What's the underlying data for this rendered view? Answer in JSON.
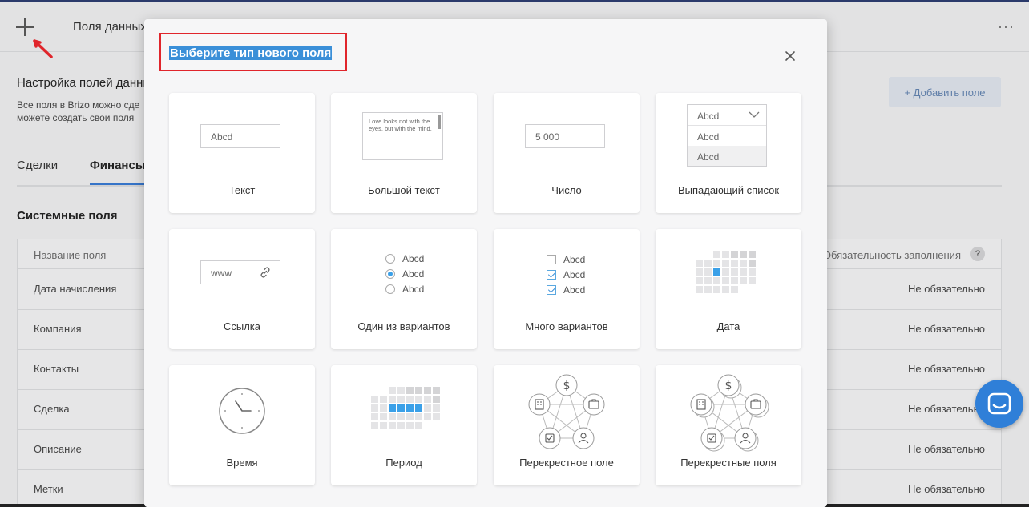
{
  "background": {
    "header_title": "Поля данных",
    "section_title": "Настройка полей данных",
    "description": "Все поля в Brizo можно сде можете создать свои поля",
    "add_button": "+ Добавить поле",
    "tabs": [
      "Сделки",
      "Финансы"
    ],
    "system_fields_title": "Системные поля",
    "table": {
      "col_name": "Название поля",
      "col_required": "Обязательность заполнения",
      "help": "?",
      "rows": [
        {
          "name": "Дата начисления",
          "required": "Не обязательно"
        },
        {
          "name": "Компания",
          "required": "Не обязательно"
        },
        {
          "name": "Контакты",
          "required": "Не обязательно"
        },
        {
          "name": "Сделка",
          "required": "Не обязательно"
        },
        {
          "name": "Описание",
          "required": "Не обязательно"
        },
        {
          "name": "Метки",
          "required": "Не обязательно"
        }
      ]
    }
  },
  "modal": {
    "title": "Выберите тип нового поля",
    "cards": {
      "text": {
        "label": "Текст",
        "sample": "Abcd"
      },
      "bigtext": {
        "label": "Большой текст",
        "sample": "Love looks not with the eyes, but with the mind."
      },
      "number": {
        "label": "Число",
        "sample": "5 000"
      },
      "dropdown": {
        "label": "Выпадающий список",
        "selected": "Abcd",
        "options": [
          "Abcd",
          "Abcd"
        ]
      },
      "link": {
        "label": "Ссылка",
        "sample": "www"
      },
      "single": {
        "label": "Один из вариантов",
        "options": [
          "Abcd",
          "Abcd",
          "Abcd"
        ]
      },
      "multi": {
        "label": "Много вариантов",
        "options": [
          "Abcd",
          "Abcd",
          "Abcd"
        ]
      },
      "date": {
        "label": "Дата"
      },
      "time": {
        "label": "Время"
      },
      "period": {
        "label": "Период"
      },
      "cross": {
        "label": "Перекрестное поле"
      },
      "crossmulti": {
        "label": "Перекрестные поля"
      }
    }
  },
  "colors": {
    "accent": "#3a8fd8",
    "highlight": "#e0252b",
    "chat": "#2f7fd8"
  }
}
